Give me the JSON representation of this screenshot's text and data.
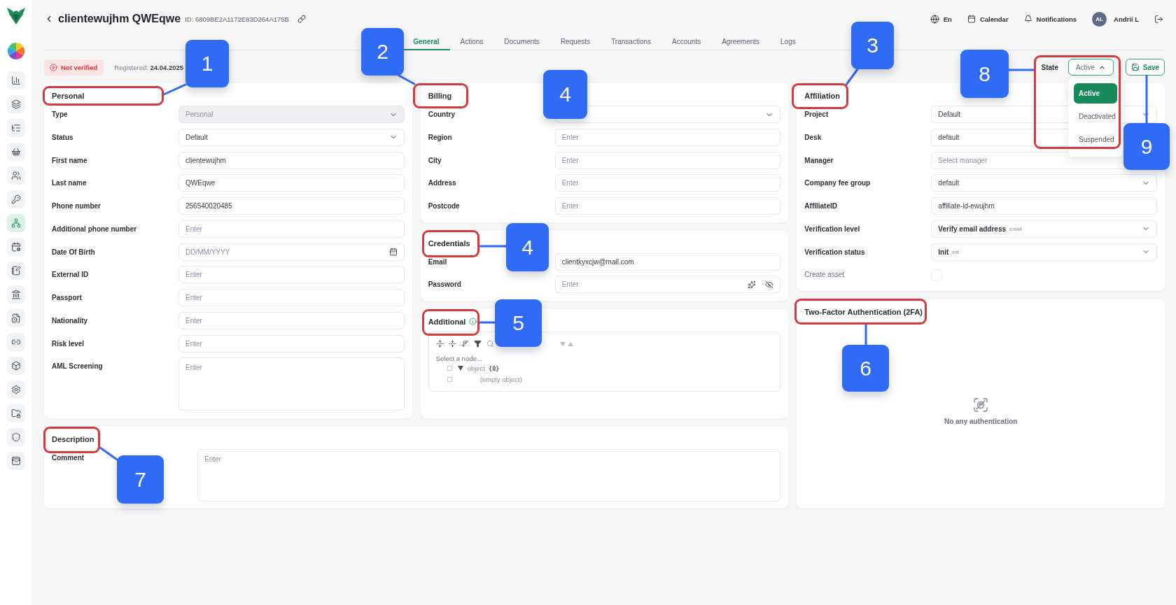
{
  "header": {
    "title": "clientewujhm QWEqwe",
    "id": "ID: 6809BE2A1172E83D264A175B",
    "language": "En",
    "calendar": "Calendar",
    "notifications": "Notifications",
    "user": {
      "initials": "AL",
      "name": "Andrii L"
    }
  },
  "sidebar": {
    "items": [
      {
        "selected": false
      },
      {
        "selected": false
      },
      {
        "selected": false
      },
      {
        "selected": false
      },
      {
        "selected": false
      },
      {
        "selected": false
      },
      {
        "selected": true
      },
      {
        "selected": false
      },
      {
        "selected": false
      },
      {
        "selected": false
      },
      {
        "selected": false
      },
      {
        "selected": false
      },
      {
        "selected": false
      },
      {
        "selected": false
      },
      {
        "selected": false
      },
      {
        "selected": false
      },
      {
        "selected": false
      }
    ]
  },
  "tabs": [
    {
      "label": "General",
      "selected": true
    },
    {
      "label": "Actions",
      "selected": false
    },
    {
      "label": "Documents",
      "selected": false
    },
    {
      "label": "Requests",
      "selected": false
    },
    {
      "label": "Transactions",
      "selected": false
    },
    {
      "label": "Accounts",
      "selected": false
    },
    {
      "label": "Agreements",
      "selected": false
    },
    {
      "label": "Logs",
      "selected": false
    }
  ],
  "status": {
    "verification": "Not verified",
    "registered": "Registered: **24.04.2025**",
    "state": {
      "label": "State",
      "value": "Active",
      "open": true,
      "options": [
        {
          "label": "Active",
          "selected": true
        },
        {
          "label": "Deactivated",
          "selected": false
        },
        {
          "label": "Suspended",
          "selected": false
        }
      ]
    },
    "save": "Save"
  },
  "personal": {
    "title": "Personal",
    "fields": [
      {
        "label": "Type",
        "kind": "select",
        "value": "Personal",
        "disabled": true
      },
      {
        "label": "Status",
        "kind": "select",
        "value": "Default",
        "disabled": false
      },
      {
        "label": "First name",
        "kind": "input",
        "value": "clientewujhm",
        "disabled": false
      },
      {
        "label": "Last name",
        "kind": "input",
        "value": "QWEqwe",
        "disabled": false
      },
      {
        "label": "Phone number",
        "kind": "input",
        "value": "256540020485",
        "disabled": false
      },
      {
        "label": "Additional phone number",
        "kind": "input",
        "placeholder": "Enter",
        "disabled": false
      },
      {
        "label": "Date Of Birth",
        "kind": "date",
        "placeholder": "DD/MM/YYYY",
        "disabled": false
      },
      {
        "label": "External ID",
        "kind": "input",
        "placeholder": "Enter",
        "disabled": false
      },
      {
        "label": "Passport",
        "kind": "input",
        "placeholder": "Enter",
        "disabled": false
      },
      {
        "label": "Nationality",
        "kind": "input",
        "placeholder": "Enter",
        "disabled": false
      },
      {
        "label": "Risk level",
        "kind": "input",
        "placeholder": "Enter",
        "disabled": false
      },
      {
        "label": "AML Screening",
        "kind": "textarea",
        "placeholder": "Enter",
        "disabled": false
      }
    ]
  },
  "billing": {
    "title": "Billing",
    "fields": [
      {
        "label": "Country",
        "kind": "select"
      },
      {
        "label": "Region",
        "kind": "input",
        "placeholder": "Enter"
      },
      {
        "label": "City",
        "kind": "input",
        "placeholder": "Enter"
      },
      {
        "label": "Address",
        "kind": "input",
        "placeholder": "Enter"
      },
      {
        "label": "Postcode",
        "kind": "input",
        "placeholder": "Enter"
      }
    ]
  },
  "credentials": {
    "title": "Credentials",
    "fields": [
      {
        "label": "Email",
        "kind": "input",
        "value": "clientkyxcjw@mail.com"
      },
      {
        "label": "Password",
        "kind": "password",
        "placeholder": "Enter"
      }
    ]
  },
  "additional": {
    "title": "Additional",
    "editor": {
      "status": "Select a node...",
      "tree": [
        {
          "key": "object",
          "count": "{0}",
          "expanded": true,
          "children": [
            {
              "key": "(empty object)"
            }
          ]
        }
      ]
    }
  },
  "affiliation": {
    "title": "Affiliation",
    "fields": [
      {
        "label": "Project",
        "kind": "select",
        "value": "Default",
        "disabled": false
      },
      {
        "label": "Desk",
        "kind": "input",
        "value": "default",
        "disabled": false
      },
      {
        "label": "Manager",
        "kind": "input",
        "placeholder": "Select manager",
        "disabled": false
      },
      {
        "label": "Company fee group",
        "kind": "select",
        "value": "default",
        "disabled": false
      },
      {
        "label": "AffiliateID",
        "kind": "input",
        "value": "affiliate-id-ewujhm",
        "disabled": false
      },
      {
        "label": "Verification level",
        "kind": "tagged-select",
        "value": "Verify email address",
        "tag": "email",
        "disabled": false
      },
      {
        "label": "Verification status",
        "kind": "tagged-select",
        "value": "Init",
        "tag": "init",
        "disabled": false
      },
      {
        "label": "Create asset",
        "kind": "checkbox",
        "checked": false,
        "disabled": true
      }
    ]
  },
  "two_factor": {
    "title": "Two-Factor Authentication (2FA)",
    "empty": "No any authentication"
  },
  "description": {
    "title": "Description",
    "fields": [
      {
        "label": "Comment",
        "kind": "textarea",
        "placeholder": "Enter"
      }
    ]
  },
  "annotations": {
    "callouts": [
      {
        "number": "1"
      },
      {
        "number": "2"
      },
      {
        "number": "3"
      },
      {
        "number": "4"
      },
      {
        "number": "4"
      },
      {
        "number": "5"
      },
      {
        "number": "6"
      },
      {
        "number": "7"
      },
      {
        "number": "8"
      },
      {
        "number": "9"
      }
    ]
  }
}
